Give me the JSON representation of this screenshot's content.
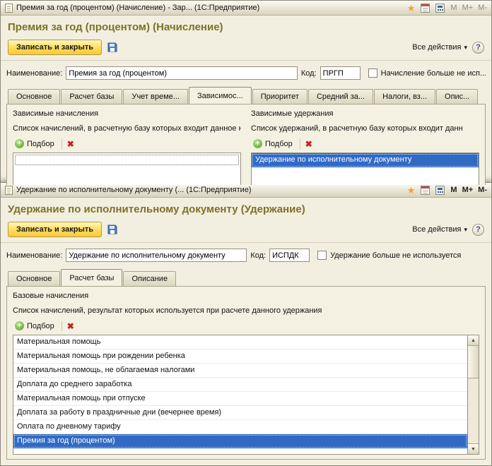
{
  "colors": {
    "selection_blue": "#316ac5",
    "primary_button_yellow": "#ffdb55",
    "form_title_olive": "#7e7227",
    "window_background": "#f2eee0"
  },
  "icons": {
    "star": "★",
    "caret_down": "▾",
    "delete": "✖",
    "plus": "+",
    "arrow_up": "▲",
    "arrow_down": "▼"
  },
  "windows": {
    "top": {
      "titlebar": {
        "title": "Премия за год (процентом) (Начисление) - Зар... (1С:Предприятие)",
        "mem_buttons": [
          {
            "label": "М"
          },
          {
            "label": "М+"
          },
          {
            "label": "М-"
          }
        ]
      },
      "form_title": "Премия за год (процентом) (Начисление)",
      "commands": {
        "save_close": "Записать и закрыть",
        "all_actions": "Все действия",
        "help": "?"
      },
      "fields": {
        "name_label": "Наименование:",
        "name_value": "Премия за год (процентом)",
        "code_label": "Код:",
        "code_value": "ПРГП",
        "checkbox_label": "Начисление больше не исп..."
      },
      "tabs": [
        {
          "label": "Основное"
        },
        {
          "label": "Расчет базы"
        },
        {
          "label": "Учет време..."
        },
        {
          "label": "Зависимос...",
          "active": true
        },
        {
          "label": "Приоритет"
        },
        {
          "label": "Средний за..."
        },
        {
          "label": "Налоги, вз..."
        },
        {
          "label": "Опис..."
        }
      ],
      "accruals_panel": {
        "title": "Зависимые начисления",
        "description": "Список начислений, в расчетную базу которых входит данное начисление",
        "pick_label": "Подбор",
        "items": []
      },
      "deductions_panel": {
        "title": "Зависимые удержания",
        "description": "Список удержаний, в расчетную базу которых входит данн",
        "pick_label": "Подбор",
        "items": [
          {
            "text": "Удержание по исполнительному документу",
            "selected": true
          }
        ]
      }
    },
    "bottom": {
      "titlebar": {
        "title": "Удержание по исполнительному документу (... (1С:Предприятие)",
        "mem_buttons": [
          {
            "label": "М"
          },
          {
            "label": "М+"
          },
          {
            "label": "М-"
          }
        ]
      },
      "form_title": "Удержание по исполнительному документу (Удержание)",
      "commands": {
        "save_close": "Записать и закрыть",
        "all_actions": "Все действия",
        "help": "?"
      },
      "fields": {
        "name_label": "Наименование:",
        "name_value": "Удержание по исполнительному документу",
        "code_label": "Код:",
        "code_value": "ИСПДК",
        "checkbox_label": "Удержание больше не используется"
      },
      "tabs": [
        {
          "label": "Основное"
        },
        {
          "label": "Расчет базы",
          "active": true
        },
        {
          "label": "Описание"
        }
      ],
      "base_panel": {
        "title": "Базовые начисления",
        "description": "Список начислений, результат которых используется при расчете данного удержания",
        "pick_label": "Подбор",
        "items": [
          {
            "text": "Материальная помощь"
          },
          {
            "text": "Материальная помощь при рождении ребенка"
          },
          {
            "text": "Материальная помощь, не облагаемая налогами"
          },
          {
            "text": "Доплата до среднего заработка"
          },
          {
            "text": "Материальная помощь при отпуске"
          },
          {
            "text": "Доплата за работу в праздничные дни (вечернее время)"
          },
          {
            "text": "Оплата по дневному тарифу"
          },
          {
            "text": "Премия за год (процентом)",
            "selected": true
          }
        ]
      }
    }
  }
}
